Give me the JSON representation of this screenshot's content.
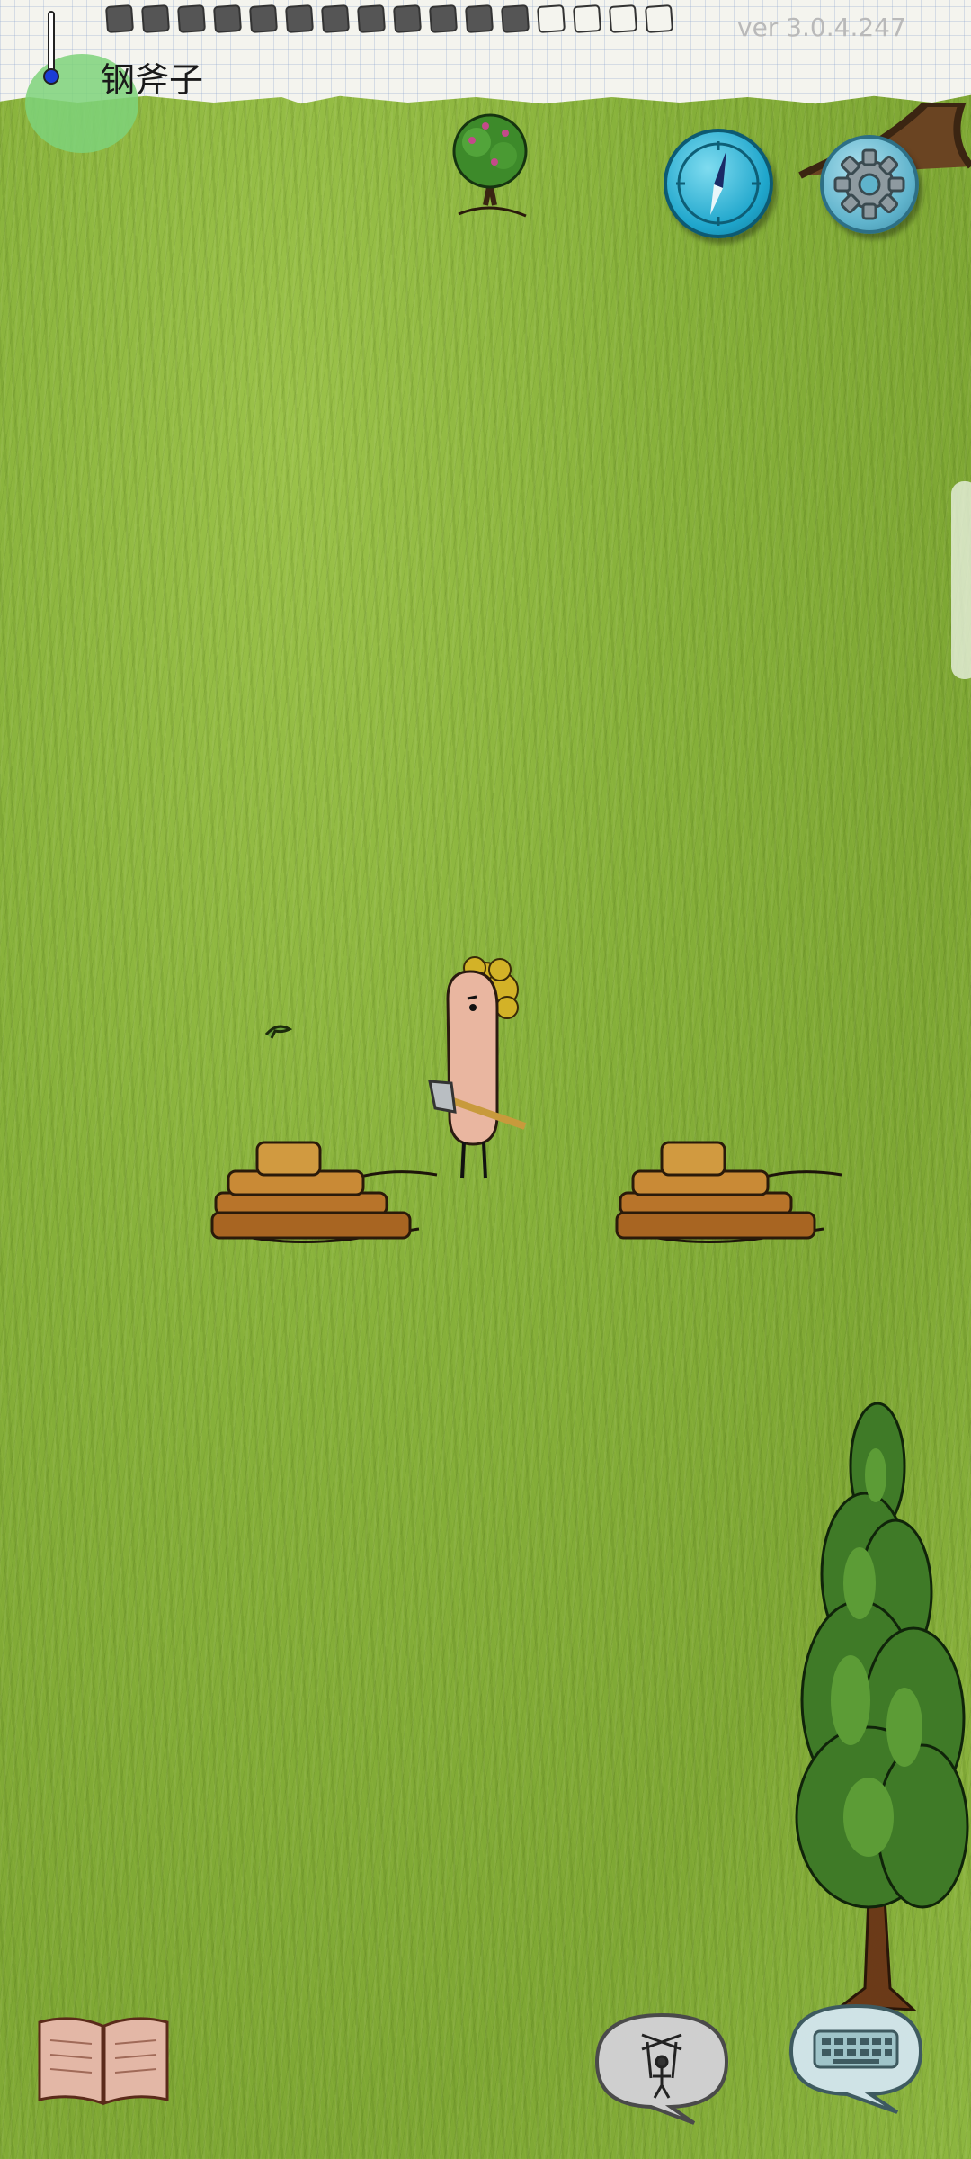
{
  "hud": {
    "held_item": "钢斧子",
    "version": "ver 3.0.4.247",
    "food_pips_filled": 12,
    "food_pips_total": 16
  },
  "icons": {
    "temperature": "thermometer-icon",
    "compass": "compass-icon",
    "settings": "gear-icon",
    "tech_tree": "book-icon",
    "emote": "puppet-icon",
    "chat": "keyboard-icon"
  },
  "colors": {
    "grass": "#86b03a",
    "paper": "#f4f4ee",
    "compass": "#1fa6cc",
    "thermometer_bulb": "#1b3dd6"
  }
}
